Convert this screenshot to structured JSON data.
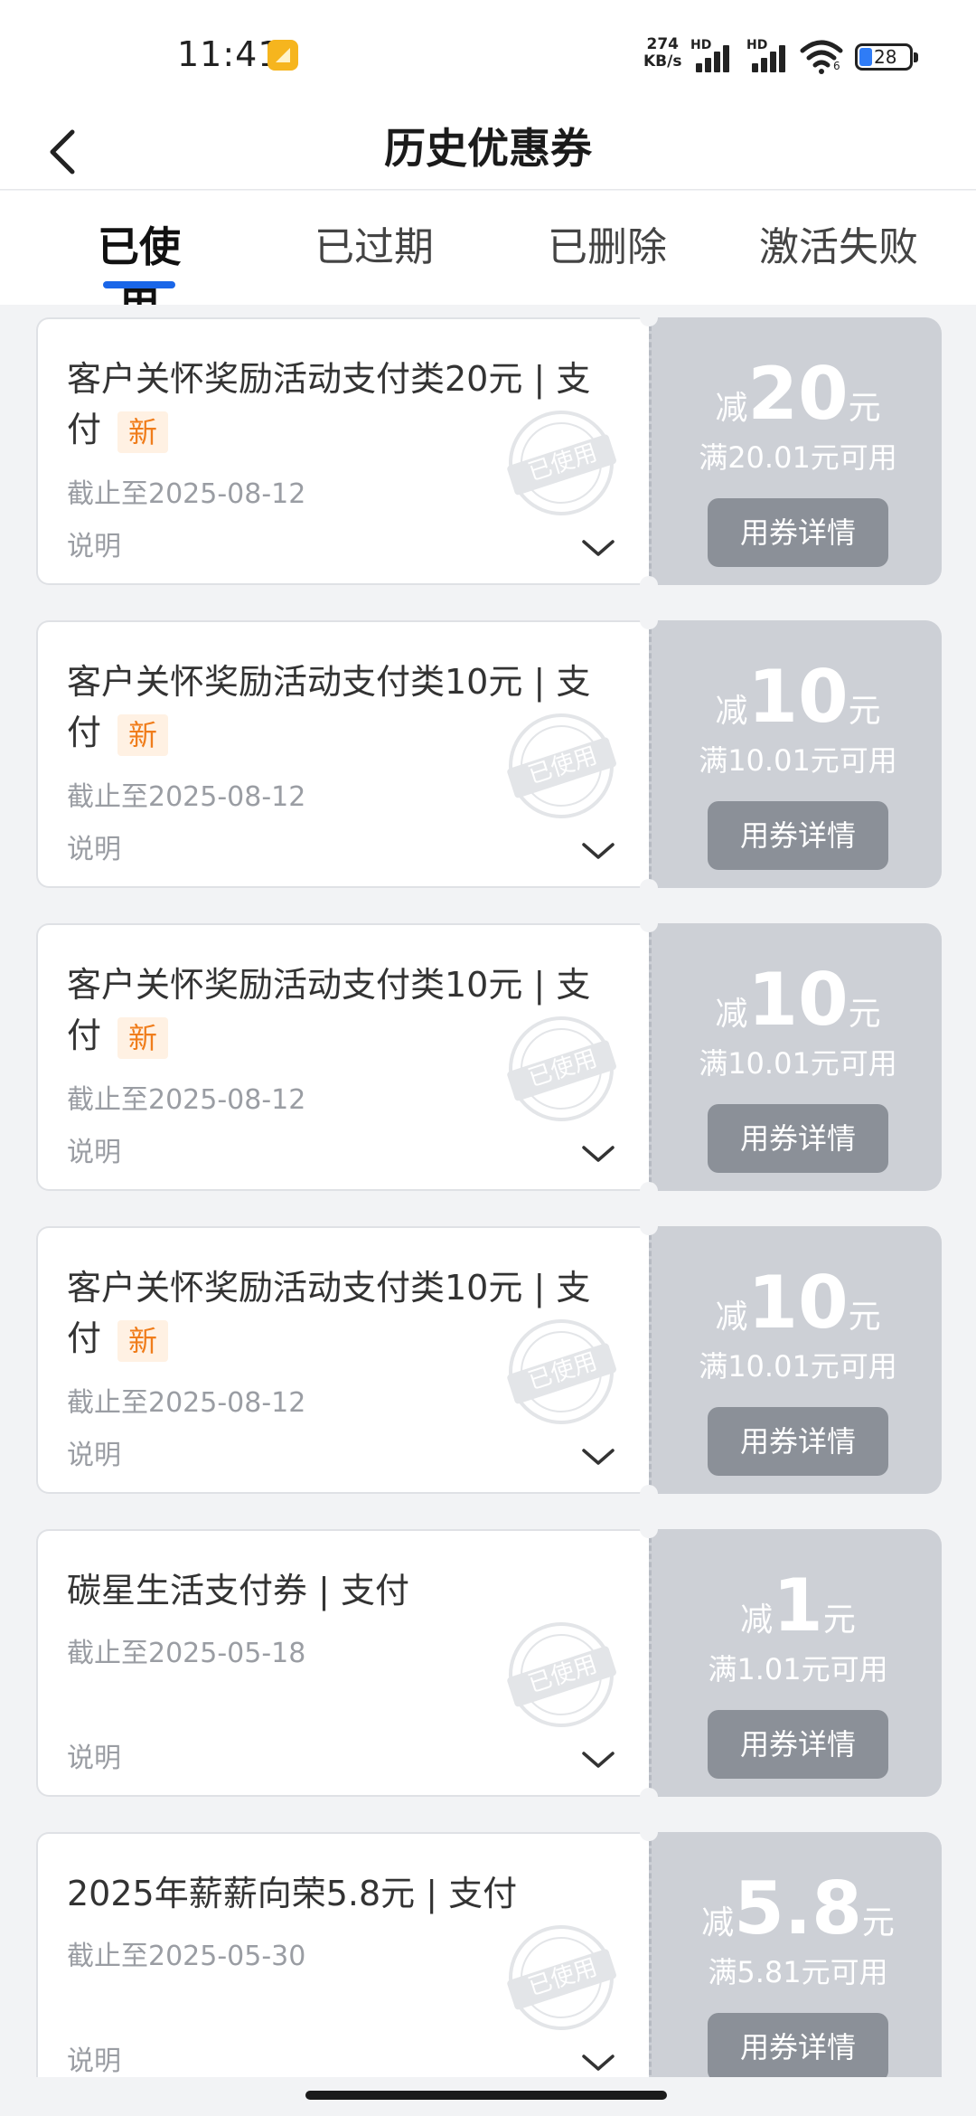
{
  "status_bar": {
    "time": "11:41",
    "network_speed_value": "274",
    "network_speed_unit": "KB/s",
    "sim1_label": "HD",
    "sim2_label": "HD",
    "wifi_label": "6",
    "battery": "28"
  },
  "header": {
    "title": "历史优惠券",
    "back_icon": "chevron-left-icon"
  },
  "tabs": [
    {
      "label": "已使用",
      "active": true
    },
    {
      "label": "已过期",
      "active": false
    },
    {
      "label": "已删除",
      "active": false
    },
    {
      "label": "激活失败",
      "active": false
    }
  ],
  "coupons": [
    {
      "title": "客户关怀奖励活动支付类20元 | 支付",
      "badge": "新",
      "date": "截止至2025-08-12",
      "desc_label": "说明",
      "amount_prefix": "减",
      "amount": "20",
      "amount_unit": "元",
      "condition": "满20.01元可用",
      "button_label": "用券详情",
      "stamp_text": "已使用"
    },
    {
      "title": "客户关怀奖励活动支付类10元 | 支付",
      "badge": "新",
      "date": "截止至2025-08-12",
      "desc_label": "说明",
      "amount_prefix": "减",
      "amount": "10",
      "amount_unit": "元",
      "condition": "满10.01元可用",
      "button_label": "用券详情",
      "stamp_text": "已使用"
    },
    {
      "title": "客户关怀奖励活动支付类10元 | 支付",
      "badge": "新",
      "date": "截止至2025-08-12",
      "desc_label": "说明",
      "amount_prefix": "减",
      "amount": "10",
      "amount_unit": "元",
      "condition": "满10.01元可用",
      "button_label": "用券详情",
      "stamp_text": "已使用"
    },
    {
      "title": "客户关怀奖励活动支付类10元 | 支付",
      "badge": "新",
      "date": "截止至2025-08-12",
      "desc_label": "说明",
      "amount_prefix": "减",
      "amount": "10",
      "amount_unit": "元",
      "condition": "满10.01元可用",
      "button_label": "用券详情",
      "stamp_text": "已使用"
    },
    {
      "title": "碳星生活支付券 | 支付",
      "badge": "",
      "date": "截止至2025-05-18",
      "desc_label": "说明",
      "amount_prefix": "减",
      "amount": "1",
      "amount_unit": "元",
      "condition": "满1.01元可用",
      "button_label": "用券详情",
      "stamp_text": "已使用"
    },
    {
      "title": "2025年薪薪向荣5.8元 | 支付",
      "badge": "",
      "date": "截止至2025-05-30",
      "desc_label": "说明",
      "amount_prefix": "减",
      "amount": "5.8",
      "amount_unit": "元",
      "condition": "满5.81元可用",
      "button_label": "用券详情",
      "stamp_text": "已使用"
    }
  ],
  "colors": {
    "accent": "#1a66e8",
    "badge_text": "#f07d1b",
    "badge_bg": "#fff1e3",
    "coupon_right_bg": "#cdd0d6",
    "detail_button_bg": "#8b9098"
  }
}
